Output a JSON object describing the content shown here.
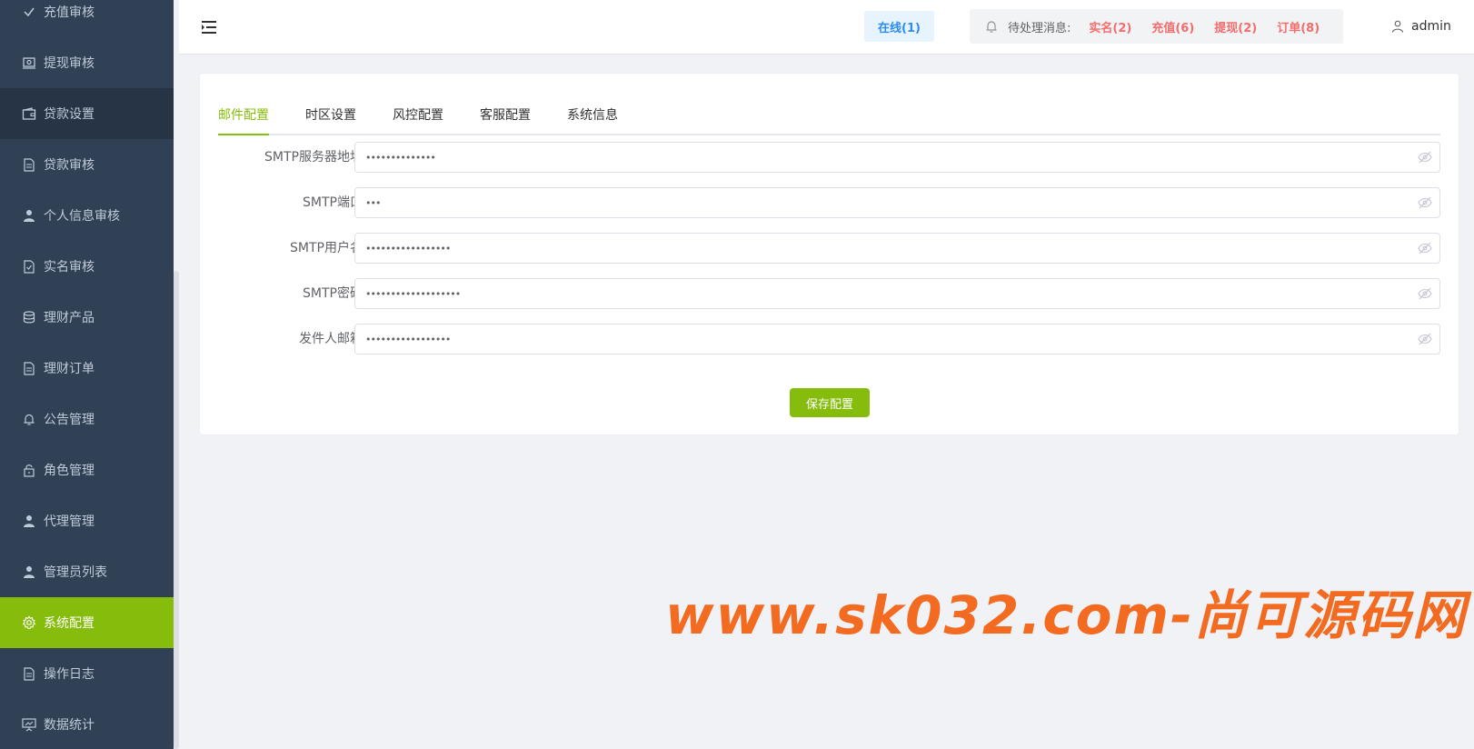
{
  "sidebar": {
    "items": [
      {
        "label": "充值审核",
        "icon": "check-icon"
      },
      {
        "label": "提现审核",
        "icon": "money-icon"
      },
      {
        "label": "贷款设置",
        "icon": "wallet-icon"
      },
      {
        "label": "贷款审核",
        "icon": "document-icon"
      },
      {
        "label": "个人信息审核",
        "icon": "user-icon"
      },
      {
        "label": "实名审核",
        "icon": "document-check-icon"
      },
      {
        "label": "理财产品",
        "icon": "coins-icon"
      },
      {
        "label": "理财订单",
        "icon": "document-icon"
      },
      {
        "label": "公告管理",
        "icon": "bell-icon"
      },
      {
        "label": "角色管理",
        "icon": "lock-icon"
      },
      {
        "label": "代理管理",
        "icon": "user-icon"
      },
      {
        "label": "管理员列表",
        "icon": "user-icon"
      },
      {
        "label": "系统配置",
        "icon": "gear-icon"
      },
      {
        "label": "操作日志",
        "icon": "document-icon"
      },
      {
        "label": "数据统计",
        "icon": "chart-board-icon"
      }
    ],
    "active_label": "系统配置",
    "hover_label": "贷款设置"
  },
  "header": {
    "online": "在线(1)",
    "pending_label": "待处理消息:",
    "pending_links": [
      "实名(2)",
      "充值(6)",
      "提现(2)",
      "订单(8)"
    ],
    "user": "admin"
  },
  "tabs": [
    "邮件配置",
    "时区设置",
    "风控配置",
    "客服配置",
    "系统信息"
  ],
  "active_tab": "邮件配置",
  "form": {
    "fields": [
      {
        "label": "SMTP服务器地址",
        "masked_value": "••••••••••••••"
      },
      {
        "label": "SMTP端口",
        "masked_value": "•••"
      },
      {
        "label": "SMTP用户名",
        "masked_value": "•••••••••••••••••"
      },
      {
        "label": "SMTP密码",
        "masked_value": "•••••••••••••••••••"
      },
      {
        "label": "发件人邮箱",
        "masked_value": "•••••••••••••••••"
      }
    ],
    "save_label": "保存配置"
  },
  "watermark": "www.sk032.com-尚可源码网",
  "colors": {
    "accent": "#86bc0c",
    "sidebar_bg": "#304156",
    "link_red": "#f56c6c",
    "online_blue": "#2d8cf0"
  }
}
